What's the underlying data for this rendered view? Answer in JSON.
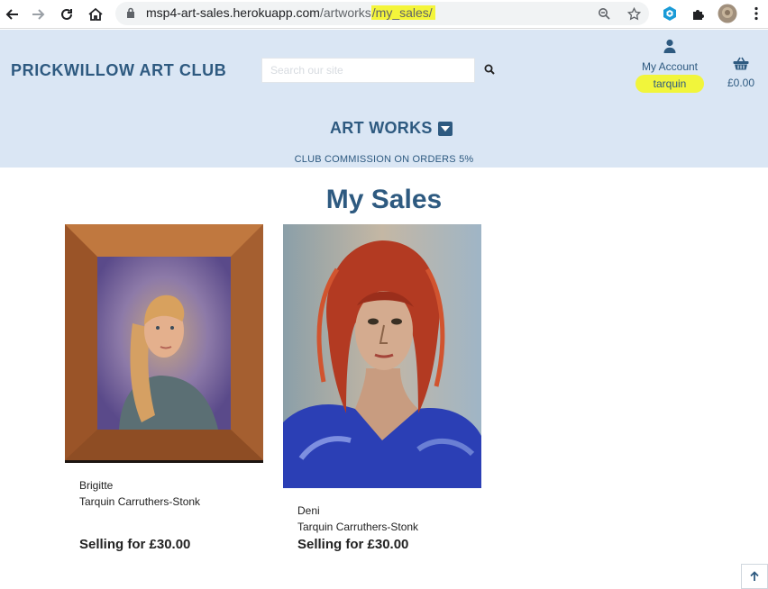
{
  "browser": {
    "url_host": "msp4-art-sales.herokuapp.com",
    "url_path": "/artworks",
    "url_highlight": "/my_sales/"
  },
  "header": {
    "brand": "PRICKWILLOW ART CLUB",
    "search_placeholder": "Search our site",
    "account_label": "My Account",
    "account_user": "tarquin",
    "basket_total": "£0.00",
    "menu_label": "ART WORKS",
    "banner": "CLUB COMMISSION ON ORDERS 5%"
  },
  "main": {
    "title": "My Sales",
    "artworks": [
      {
        "title": "Brigitte",
        "artist": "Tarquin Carruthers-Stonk",
        "price": "Selling for £30.00"
      },
      {
        "title": "Deni",
        "artist": "Tarquin Carruthers-Stonk",
        "price": "Selling for £30.00"
      }
    ]
  },
  "colors": {
    "header_bg": "#dae6f4",
    "brand": "#2e5a80",
    "highlight": "#f1f53b"
  },
  "icons": [
    "back-icon",
    "forward-icon",
    "reload-icon",
    "home-icon",
    "lock-icon",
    "zoom-icon",
    "star-icon",
    "extension-icon",
    "puzzle-icon",
    "profile-avatar",
    "menu-dots-icon",
    "search-icon",
    "user-icon",
    "basket-icon",
    "caret-down-icon",
    "arrow-up-icon"
  ]
}
